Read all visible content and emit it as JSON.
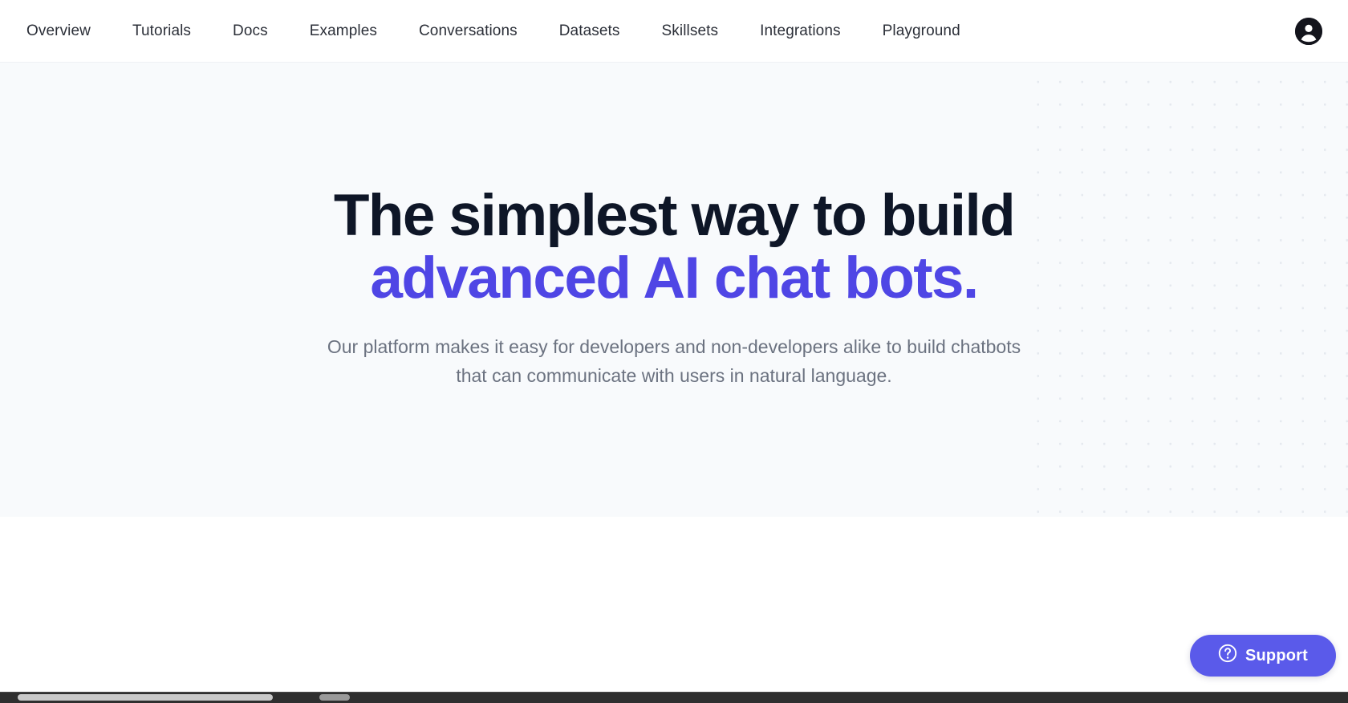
{
  "header": {
    "nav_items": [
      {
        "label": "Overview"
      },
      {
        "label": "Tutorials"
      },
      {
        "label": "Docs"
      },
      {
        "label": "Examples"
      },
      {
        "label": "Conversations"
      },
      {
        "label": "Datasets"
      },
      {
        "label": "Skillsets"
      },
      {
        "label": "Integrations"
      },
      {
        "label": "Playground"
      }
    ],
    "account": {
      "icon": "user-avatar-icon",
      "color": "#13141c"
    },
    "border_color": "#eef0f4"
  },
  "hero": {
    "background": "#f8fafc",
    "headline_line1": "The simplest way to build",
    "headline_line2": "advanced AI chat bots.",
    "headline_color": "#0e1627",
    "headline_accent_color": "#4f46e5",
    "subhead_line1": "Our platform makes it easy for developers and non-developers alike to build chatbots",
    "subhead_line2": "that can communicate with users in natural language.",
    "subhead_color": "#6b7280",
    "dot_pattern_color": "#e4e8ee"
  },
  "support_widget": {
    "label": "Support",
    "icon": "question-circle-icon",
    "color": "#5a5aea"
  },
  "scrollbar": {
    "orientation": "horizontal",
    "track_color": "#2f2f2f",
    "thumb_color": "#c9c9c9"
  }
}
